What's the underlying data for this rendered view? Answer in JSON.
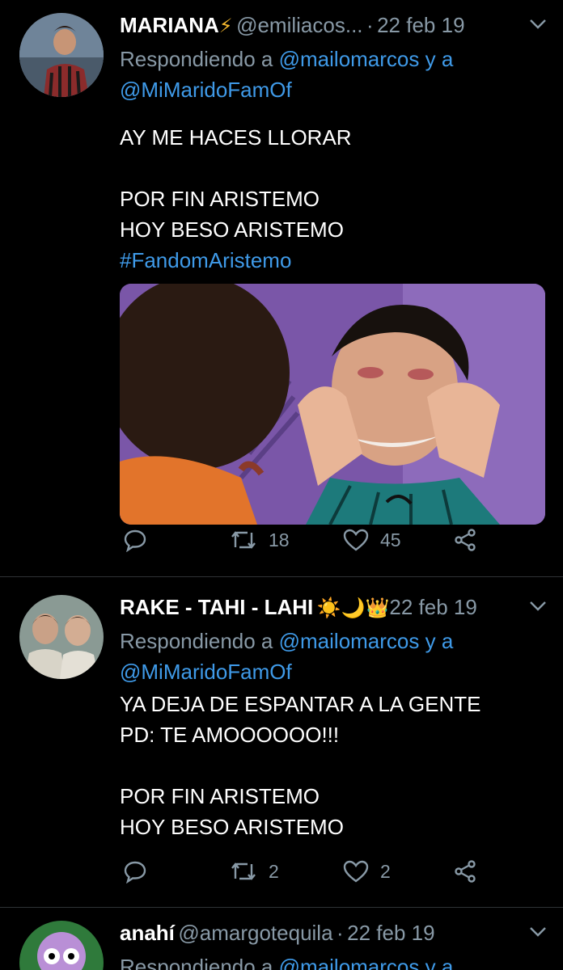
{
  "tweets": [
    {
      "name": "MARIANA",
      "name_emoji": "⚡",
      "handle": "@emiliacos...",
      "date": "22 feb 19",
      "reply_prefix": "Respondiendo a",
      "mention1": "@mailomarcos",
      "reply_join": "y a",
      "mention2": "@MiMaridoFamOf",
      "text": "AY ME HACES LLORAR\n\nPOR FIN ARISTEMO\nHOY BESO ARISTEMO",
      "hashtag": "#FandomAristemo",
      "retweets": "18",
      "likes": "45"
    },
    {
      "name": "RAKE - TAHI - LAHI",
      "name_emoji": "☀️🌙👑",
      "date": "22 feb 19",
      "reply_prefix": "Respondiendo a",
      "mention1": "@mailomarcos",
      "reply_join": "y a",
      "mention2": "@MiMaridoFamOf",
      "text": "YA DEJA DE ESPANTAR A LA GENTE\nPD: TE AMOOOOOO!!!\n\nPOR FIN ARISTEMO\nHOY BESO ARISTEMO",
      "retweets": "2",
      "likes": "2"
    },
    {
      "name": "anahí",
      "handle": "@amargotequila",
      "date": "22 feb 19",
      "reply_prefix": "Respondiendo a",
      "mention1": "@mailomarcos",
      "reply_join": "y a"
    }
  ],
  "separator": "·",
  "icons": {
    "reply": "reply-icon",
    "retweet": "retweet-icon",
    "like": "heart-icon",
    "share": "share-icon",
    "menu": "chevron-down-icon"
  },
  "colors": {
    "background": "#000000",
    "link": "#3f9ae8",
    "muted": "#8899a6"
  }
}
